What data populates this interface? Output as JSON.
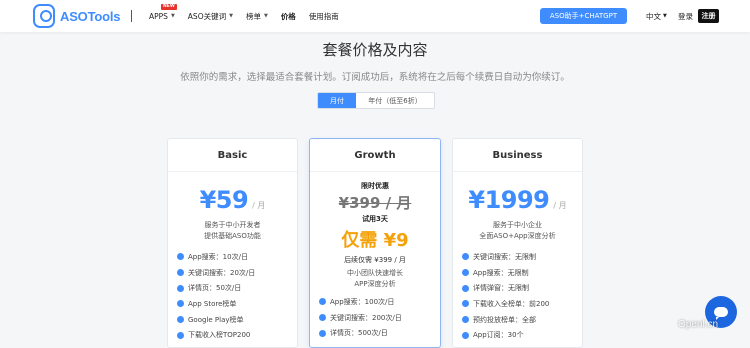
{
  "header": {
    "logo_text": "ASOTools",
    "nav": [
      {
        "label": "APPS",
        "badge": "NEW",
        "caret": true
      },
      {
        "label": "ASO关键词",
        "caret": true
      },
      {
        "label": "榜单",
        "caret": true
      },
      {
        "label": "价格",
        "active": true
      },
      {
        "label": "使用指南"
      }
    ],
    "aso_button": "ASO助手+CHATGPT",
    "language": "中文",
    "login": "登录",
    "register": "注册"
  },
  "page": {
    "title": "套餐价格及内容",
    "subtitle": "依照你的需求，选择最适合套餐计划。订阅成功后，系统将在之后每个续费日自动为你续订。",
    "billing_toggle": {
      "monthly": "月付",
      "yearly": "年付（低至6折）",
      "selected": "monthly"
    }
  },
  "plans": [
    {
      "name": "Basic",
      "price": "¥59",
      "unit": "/ 月",
      "desc_lines": [
        "服务于中小开发者",
        "提供基础ASO功能"
      ],
      "features": [
        "App搜索：10次/日",
        "关键词搜索：20次/日",
        "详情页：50次/日",
        "App Store榜单",
        "Google Play榜单",
        "下载收入榜TOP200"
      ]
    },
    {
      "name": "Growth",
      "promo_label": "限时优惠",
      "original_price": "¥399 / 月",
      "trial": "试用3天",
      "now_price": "仅需 ¥9",
      "after_price": "后续仅需 ¥399 / 月",
      "desc_lines": [
        "中小团队快速增长",
        "APP深度分析"
      ],
      "features": [
        "App搜索：100次/日",
        "关键词搜索：200次/日",
        "详情页：500次/日"
      ]
    },
    {
      "name": "Business",
      "price": "¥1999",
      "unit": "/ 月",
      "desc_lines": [
        "服务于中小企业",
        "全面ASO+App深度分析"
      ],
      "features": [
        "关键词搜索：无限制",
        "App搜索：无限制",
        "详情弹窗：无限制",
        "下载收入全榜单：前200",
        "预约投放榜单：全部",
        "App订阅：30个"
      ]
    }
  ],
  "watermark": "Openl.cn",
  "colors": {
    "accent": "#3f8cff",
    "promo": "#f5a10a",
    "badge": "#e8322b"
  }
}
